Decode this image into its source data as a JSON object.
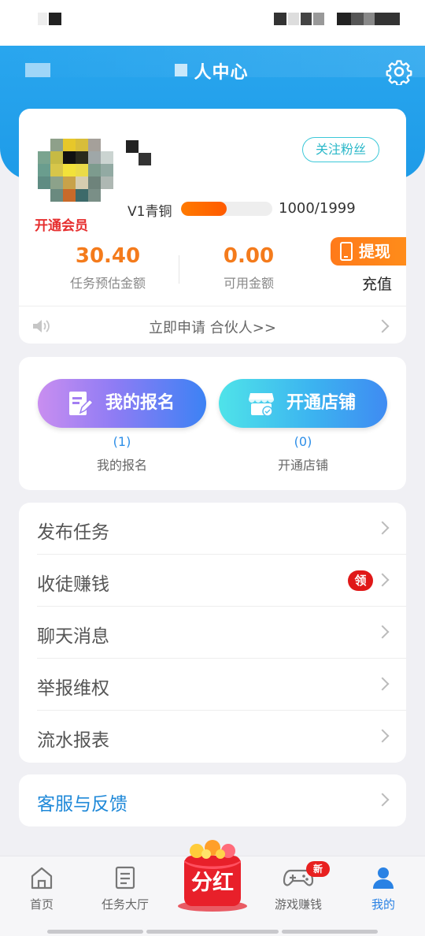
{
  "header": {
    "title": "人中心"
  },
  "profile": {
    "vip_link": "开通会员",
    "follow_label": "关注粉丝",
    "level_name": "V1青铜",
    "level_progress": 0.5,
    "level_count": "1000/1999",
    "stats": [
      {
        "value": "30.40",
        "label": "任务预估金额"
      },
      {
        "value": "0.00",
        "label": "可用金额"
      }
    ],
    "withdraw_label": "提现",
    "recharge_label": "充值",
    "notice": "立即申请 合伙人>>"
  },
  "actions": [
    {
      "label": "我的报名",
      "count": "(1)",
      "caption": "我的报名"
    },
    {
      "label": "开通店铺",
      "count": "(0)",
      "caption": "开通店铺"
    }
  ],
  "menu": [
    {
      "label": "发布任务"
    },
    {
      "label": "收徒赚钱",
      "badge": "领"
    },
    {
      "label": "聊天消息"
    },
    {
      "label": "举报维权"
    },
    {
      "label": "流水报表"
    }
  ],
  "service": {
    "label": "客服与反馈"
  },
  "tabs": [
    {
      "label": "首页",
      "icon": "home-icon"
    },
    {
      "label": "任务大厅",
      "icon": "task-list-icon"
    },
    {
      "label": "分红",
      "icon": "red-envelope-icon"
    },
    {
      "label": "游戏赚钱",
      "icon": "gamepad-icon",
      "badge": "新"
    },
    {
      "label": "我的",
      "icon": "person-icon",
      "active": true
    }
  ],
  "colors": {
    "accent": "#2a82e4",
    "orange": "#f47b1c",
    "header_blue": "#1e9be8",
    "badge_red": "#e01818"
  }
}
